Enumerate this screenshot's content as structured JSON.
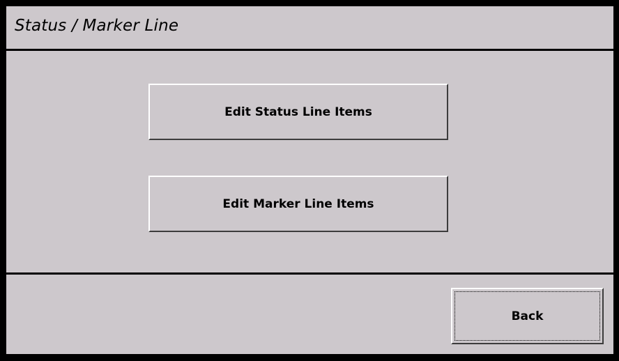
{
  "title": "Status / Marker Line",
  "buttons": {
    "edit_status": "Edit Status Line Items",
    "edit_marker": "Edit Marker Line Items",
    "back": "Back"
  }
}
